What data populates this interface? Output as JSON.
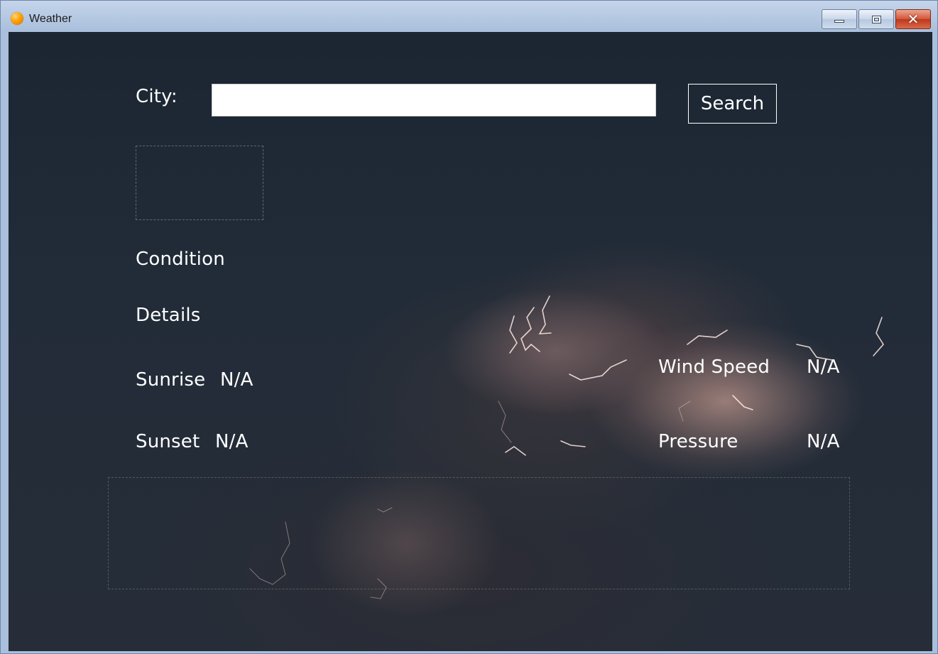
{
  "window": {
    "title": "Weather",
    "minimize_label": "",
    "maximize_label": "",
    "close_label": "✕"
  },
  "search": {
    "city_label": "City:",
    "input_value": "",
    "button_label": "Search"
  },
  "weather": {
    "condition": "Condition",
    "details": "Details",
    "sunrise_label": "Sunrise",
    "sunrise_value": "N/A",
    "sunset_label": "Sunset",
    "sunset_value": "N/A",
    "wind_speed_label": "Wind Speed",
    "wind_speed_value": "N/A",
    "pressure_label": "Pressure",
    "pressure_value": "N/A"
  },
  "icons": {
    "app": "sun-icon",
    "minimize": "minimize-icon",
    "maximize": "maximize-icon",
    "close": "close-icon"
  },
  "colors": {
    "text": "#ffffff",
    "background_dark": "#1b2632",
    "close_button": "#c0361a"
  }
}
